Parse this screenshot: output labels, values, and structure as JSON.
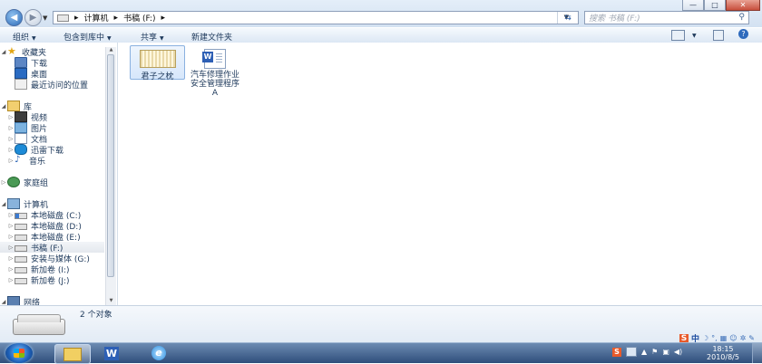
{
  "address": {
    "segments": [
      "计算机",
      "书稿 (F:)"
    ]
  },
  "search": {
    "placeholder": "搜索 书稿 (F:)"
  },
  "toolbar": {
    "organize": "组织",
    "include_library": "包含到库中",
    "share": "共享",
    "new_folder": "新建文件夹"
  },
  "nav": {
    "favorites": "收藏夹",
    "downloads": "下载",
    "desktop": "桌面",
    "recent": "最近访问的位置",
    "libraries": "库",
    "videos": "视频",
    "pictures": "图片",
    "documents": "文档",
    "thunder": "迅雷下载",
    "music": "音乐",
    "homegroup": "家庭组",
    "computer": "计算机",
    "drive_c": "本地磁盘 (C:)",
    "drive_d": "本地磁盘 (D:)",
    "drive_e": "本地磁盘 (E:)",
    "drive_f": "书稿 (F:)",
    "drive_g": "安装与媒体 (G:)",
    "drive_i": "新加卷 (I:)",
    "drive_j": "新加卷 (J:)",
    "network": "网络"
  },
  "files": [
    {
      "name": "君子之枕",
      "type": "folder"
    },
    {
      "name": "汽车修理作业安全管理程序A",
      "type": "word-document"
    }
  ],
  "details": {
    "count": "2 个对象"
  },
  "ime": {
    "s": "S",
    "mode": "中"
  },
  "tray": {
    "s": "S"
  },
  "clock": {
    "time": "18:15",
    "date": "2010/8/5"
  },
  "window_buttons": {
    "minimize": "—",
    "maximize": "□",
    "close": "✕"
  },
  "colors": {
    "accent": "#2d6bb8",
    "selection": "#d7e7fb",
    "taskbar": "#2f4e7b"
  }
}
